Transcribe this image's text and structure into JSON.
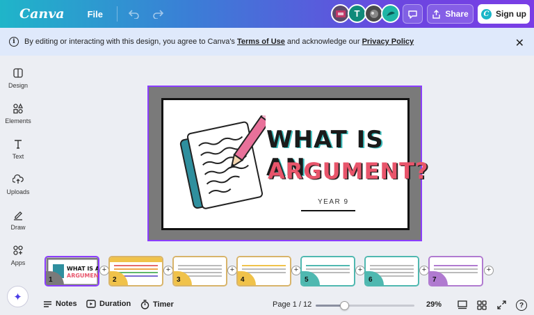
{
  "topbar": {
    "logo": "Canva",
    "file_label": "File",
    "avatar_initial": "T",
    "share_label": "Share",
    "signup_label": "Sign up",
    "signup_badge": "C"
  },
  "banner": {
    "text_before": "By editing or interacting with this design, you agree to Canva's ",
    "terms_link": "Terms of Use",
    "text_middle": " and acknowledge our ",
    "privacy_link": "Privacy Policy",
    "info_glyph": "i",
    "close_glyph": "✕"
  },
  "sidebar": {
    "items": [
      {
        "label": "Design",
        "icon": "design-icon"
      },
      {
        "label": "Elements",
        "icon": "elements-icon"
      },
      {
        "label": "Text",
        "icon": "text-icon"
      },
      {
        "label": "Uploads",
        "icon": "uploads-icon"
      },
      {
        "label": "Draw",
        "icon": "draw-icon"
      },
      {
        "label": "Apps",
        "icon": "apps-icon"
      }
    ],
    "magic_glyph": "✦"
  },
  "slide": {
    "title_line1": "WHAT IS AN",
    "title_line2": "ARGUMENT?",
    "subtitle": "YEAR 9",
    "colors": {
      "frame": "#7a7a7a",
      "title_shadow": "#3fc2c2",
      "title2": "#e8556b",
      "selection": "#8b3dff"
    }
  },
  "filmstrip": {
    "thumbnails": [
      {
        "number": "1",
        "color": "#7a7a7a"
      },
      {
        "number": "2",
        "color": "#f0c24a"
      },
      {
        "number": "3",
        "color": "#f0c24a"
      },
      {
        "number": "4",
        "color": "#f0c24a"
      },
      {
        "number": "5",
        "color": "#4fb8b0"
      },
      {
        "number": "6",
        "color": "#4fb8b0"
      },
      {
        "number": "7",
        "color": "#b07ad0"
      }
    ],
    "add_glyph": "+"
  },
  "bottombar": {
    "notes_label": "Notes",
    "duration_label": "Duration",
    "timer_label": "Timer",
    "page_label": "Page 1 / 12",
    "zoom_label": "29%",
    "zoom_fraction": 0.29,
    "help_glyph": "?"
  }
}
